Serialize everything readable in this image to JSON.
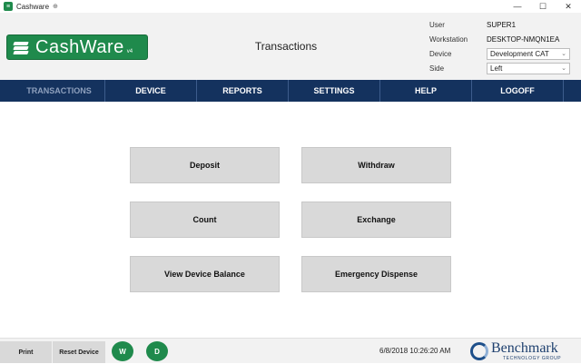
{
  "window": {
    "title": "Cashware",
    "pin_glyph": "⊕",
    "controls": {
      "minimize": "—",
      "maximize": "☐",
      "close": "✕"
    }
  },
  "header": {
    "logo_text": "CashWare",
    "logo_version": "v4",
    "page_title": "Transactions",
    "info": {
      "user_label": "User",
      "user_value": "SUPER1",
      "workstation_label": "Workstation",
      "workstation_value": "DESKTOP-NMQN1EA",
      "device_label": "Device",
      "device_value": "Development CAT",
      "side_label": "Side",
      "side_value": "Left"
    }
  },
  "nav": {
    "items": [
      {
        "label": "TRANSACTIONS",
        "active": true
      },
      {
        "label": "DEVICE"
      },
      {
        "label": "REPORTS"
      },
      {
        "label": "SETTINGS"
      },
      {
        "label": "HELP"
      },
      {
        "label": "LOGOFF"
      }
    ]
  },
  "actions": {
    "deposit": "Deposit",
    "withdraw": "Withdraw",
    "count": "Count",
    "exchange": "Exchange",
    "view_device_balance": "View Device Balance",
    "emergency_dispense": "Emergency Dispense"
  },
  "footer": {
    "print": "Print",
    "reset_device": "Reset Device",
    "w_label": "W",
    "d_label": "D",
    "datetime": "6/8/2018 10:26:20 AM",
    "brand_name": "Benchmark",
    "brand_sub": "TECHNOLOGY GROUP"
  },
  "colors": {
    "brand_green": "#1f8a4c",
    "nav_blue": "#14325e",
    "button_gray": "#d9d9d9",
    "brand_blue": "#1d3f6e"
  },
  "icons": {
    "app": "cashware-app-icon",
    "chevron": "chevron-down-icon",
    "brand": "benchmark-globe-icon"
  }
}
